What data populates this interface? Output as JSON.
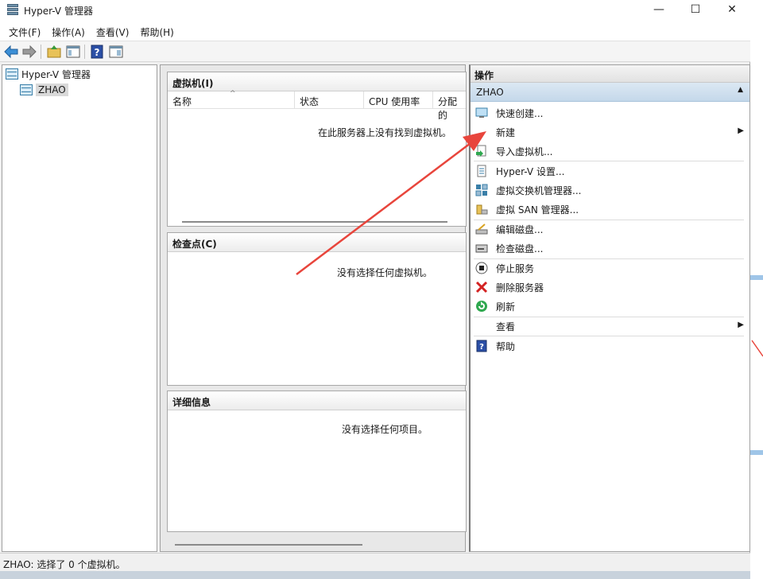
{
  "window": {
    "title": "Hyper-V 管理器",
    "minimize": "—",
    "maximize": "☐",
    "close": "✕"
  },
  "menu": [
    "文件(F)",
    "操作(A)",
    "查看(V)",
    "帮助(H)"
  ],
  "tree": {
    "root": "Hyper-V 管理器",
    "server": "ZHAO"
  },
  "vm_panel": {
    "title": "虚拟机(I)",
    "columns": [
      "名称",
      "状态",
      "CPU 使用率",
      "分配的"
    ],
    "empty": "在此服务器上没有找到虚拟机。"
  },
  "checkpoint_panel": {
    "title": "检查点(C)",
    "empty": "没有选择任何虚拟机。"
  },
  "details_panel": {
    "title": "详细信息",
    "empty": "没有选择任何项目。"
  },
  "actions": {
    "header": "操作",
    "group": "ZHAO",
    "items": [
      {
        "label": "快速创建...",
        "icon": "quick-create-icon"
      },
      {
        "label": "新建",
        "icon": "blank",
        "submenu": true
      },
      {
        "label": "导入虚拟机...",
        "icon": "import-icon"
      },
      {
        "label": "Hyper-V 设置...",
        "icon": "settings-icon"
      },
      {
        "label": "虚拟交换机管理器...",
        "icon": "switch-icon"
      },
      {
        "label": "虚拟 SAN 管理器...",
        "icon": "san-icon"
      },
      {
        "label": "编辑磁盘...",
        "icon": "edit-disk-icon"
      },
      {
        "label": "检查磁盘...",
        "icon": "inspect-disk-icon"
      },
      {
        "label": "停止服务",
        "icon": "stop-icon"
      },
      {
        "label": "删除服务器",
        "icon": "delete-icon"
      },
      {
        "label": "刷新",
        "icon": "refresh-icon"
      },
      {
        "label": "查看",
        "icon": "blank",
        "submenu": true
      },
      {
        "label": "帮助",
        "icon": "help-icon"
      }
    ]
  },
  "status": "ZHAO:  选择了 0 个虚拟机。",
  "colors": {
    "annotation_arrow": "#e8453c",
    "group_header": "#c4d8ea"
  }
}
